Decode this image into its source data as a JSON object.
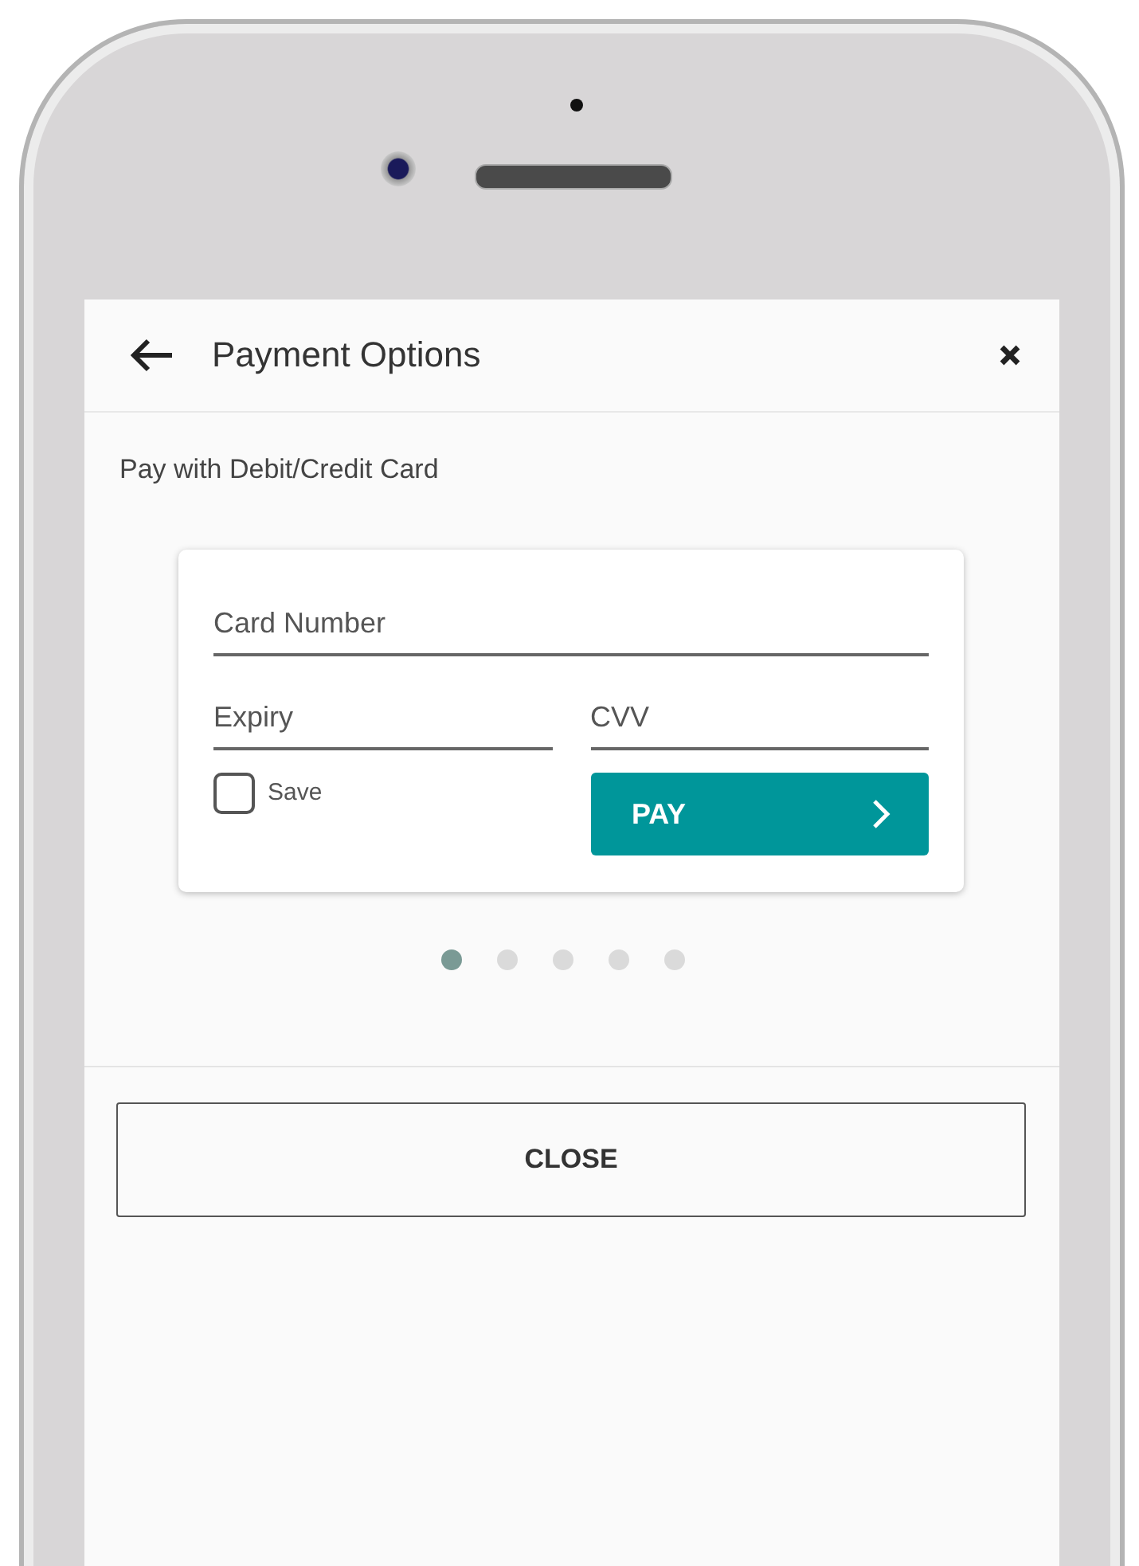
{
  "header": {
    "title": "Payment Options"
  },
  "subtitle": "Pay with Debit/Credit Card",
  "card_form": {
    "card_number": {
      "placeholder": "Card Number"
    },
    "expiry": {
      "placeholder": "Expiry"
    },
    "cvv": {
      "placeholder": "CVV"
    },
    "save": {
      "label": "Save",
      "checked": false
    },
    "pay_button": {
      "label": "PAY"
    }
  },
  "pager_dots": [
    {
      "selected": true
    },
    {
      "selected": false
    },
    {
      "selected": false
    },
    {
      "selected": false
    },
    {
      "selected": false
    }
  ],
  "close_button": {
    "label": "CLOSE"
  }
}
